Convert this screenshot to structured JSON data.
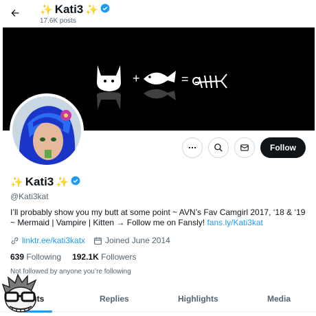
{
  "header": {
    "title": "Kati3",
    "sparkle_left": "✨",
    "sparkle_right": "✨",
    "post_count": "17.6K posts"
  },
  "profile": {
    "display_name": "Kati3",
    "sparkle_left": "✨",
    "sparkle_right": "✨",
    "handle": "@Kati3kat",
    "bio_text": "I’ll probably show you my butt at some point ~ AVN’s Fav Camgirl 2017, ‘18 & ‘19 ~ Mermaid | Vampire | Kitten → Follow me on Fansly! ",
    "bio_link": "fans.ly/Kati3kat",
    "website": "linktr.ee/kati3katx",
    "joined": "Joined June 2014",
    "following_count": "639",
    "following_label": "Following",
    "followers_count": "192.1K",
    "followers_label": "Followers",
    "not_followed_text": "Not followed by anyone you’re following"
  },
  "actions": {
    "follow_label": "Follow"
  },
  "tabs": [
    {
      "label": "sts"
    },
    {
      "label": "Replies"
    },
    {
      "label": "Highlights"
    },
    {
      "label": "Media"
    }
  ],
  "colors": {
    "accent": "#1d9bf0",
    "text": "#0f1419",
    "muted": "#536471",
    "follow_button": "#0f1419"
  }
}
